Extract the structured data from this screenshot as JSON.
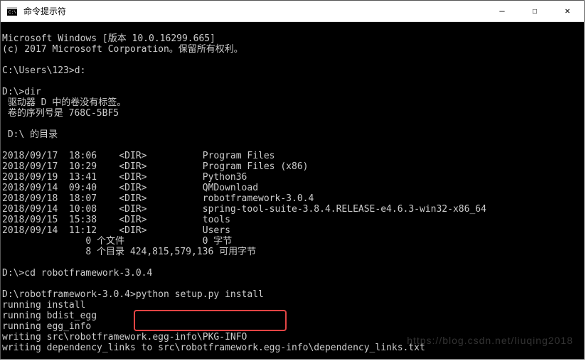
{
  "window": {
    "title": "命令提示符",
    "icon_label": "cmd-icon"
  },
  "controls": {
    "minimize": "—",
    "maximize": "☐",
    "close": "✕"
  },
  "terminal": {
    "header1": "Microsoft Windows [版本 10.0.16299.665]",
    "header2": "(c) 2017 Microsoft Corporation。保留所有权利。",
    "prompt1": "C:\\Users\\123>d:",
    "prompt2": "D:\\>dir",
    "vol1": " 驱动器 D 中的卷没有标签。",
    "vol2": " 卷的序列号是 768C-5BF5",
    "dirhdr": " D:\\ 的目录",
    "r1": "2018/09/17  18:06    <DIR>          Program Files",
    "r2": "2018/09/17  10:29    <DIR>          Program Files (x86)",
    "r3": "2018/09/19  13:41    <DIR>          Python36",
    "r4": "2018/09/14  09:40    <DIR>          QMDownload",
    "r5": "2018/09/18  18:07    <DIR>          robotframework-3.0.4",
    "r6": "2018/09/14  10:08    <DIR>          spring-tool-suite-3.8.4.RELEASE-e4.6.3-win32-x86_64",
    "r7": "2018/09/15  15:38    <DIR>          tools",
    "r8": "2018/09/14  11:12    <DIR>          Users",
    "sum1": "               0 个文件              0 字节",
    "sum2": "               8 个目录 424,815,579,136 可用字节",
    "prompt3": "D:\\>cd robotframework-3.0.4",
    "prompt4": "D:\\robotframework-3.0.4>python setup.py install",
    "o1": "running install",
    "o2": "running bdist_egg",
    "o3": "running egg_info",
    "o4": "writing src\\robotframework.egg-info\\PKG-INFO",
    "o5": "writing dependency_links to src\\robotframework.egg-info\\dependency_links.txt"
  },
  "watermark": "https://blog.csdn.net/liuqing2018"
}
